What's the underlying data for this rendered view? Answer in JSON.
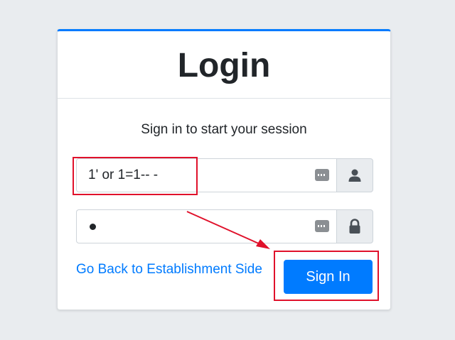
{
  "login": {
    "title": "Login",
    "message": "Sign in to start your session",
    "username_value": "1' or 1=1-- -",
    "password_mask": "•",
    "back_link": "Go Back to Establishment Side",
    "sign_in_label": "Sign In"
  },
  "icons": {
    "username_addon": "user-icon",
    "password_addon": "lock-icon",
    "password_manager": "password-manager-icon"
  },
  "colors": {
    "accent": "#007bff",
    "annotation": "#e0112b",
    "background": "#e9ecef"
  }
}
